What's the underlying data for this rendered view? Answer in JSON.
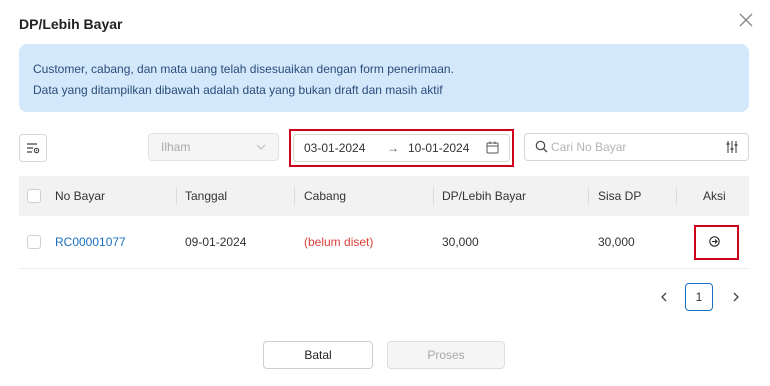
{
  "dialog": {
    "title": "DP/Lebih Bayar"
  },
  "alert": {
    "line1": "Customer, cabang, dan mata uang telah disesuaikan dengan form penerimaan.",
    "line2": "Data yang ditampilkan dibawah adalah data yang bukan draft dan masih aktif"
  },
  "filters": {
    "select_value": "Ilham",
    "date_from": "03-01-2024",
    "date_to": "10-01-2024",
    "date_arrow": "→",
    "search_placeholder": "Cari No Bayar"
  },
  "table": {
    "columns": [
      "No Bayar",
      "Tanggal",
      "Cabang",
      "DP/Lebih Bayar",
      "Sisa DP",
      "Aksi"
    ],
    "rows": [
      {
        "no_bayar": "RC00001077",
        "tanggal": "09-01-2024",
        "cabang": "(belum diset)",
        "dp": "30,000",
        "sisa": "30,000"
      }
    ]
  },
  "pagination": {
    "current": "1"
  },
  "buttons": {
    "cancel": "Batal",
    "process": "Proses"
  },
  "colors": {
    "link": "#1a6fc2",
    "warning_text": "#d9413a",
    "highlight": "#d0021b",
    "alert_bg": "#d4e8fc"
  }
}
